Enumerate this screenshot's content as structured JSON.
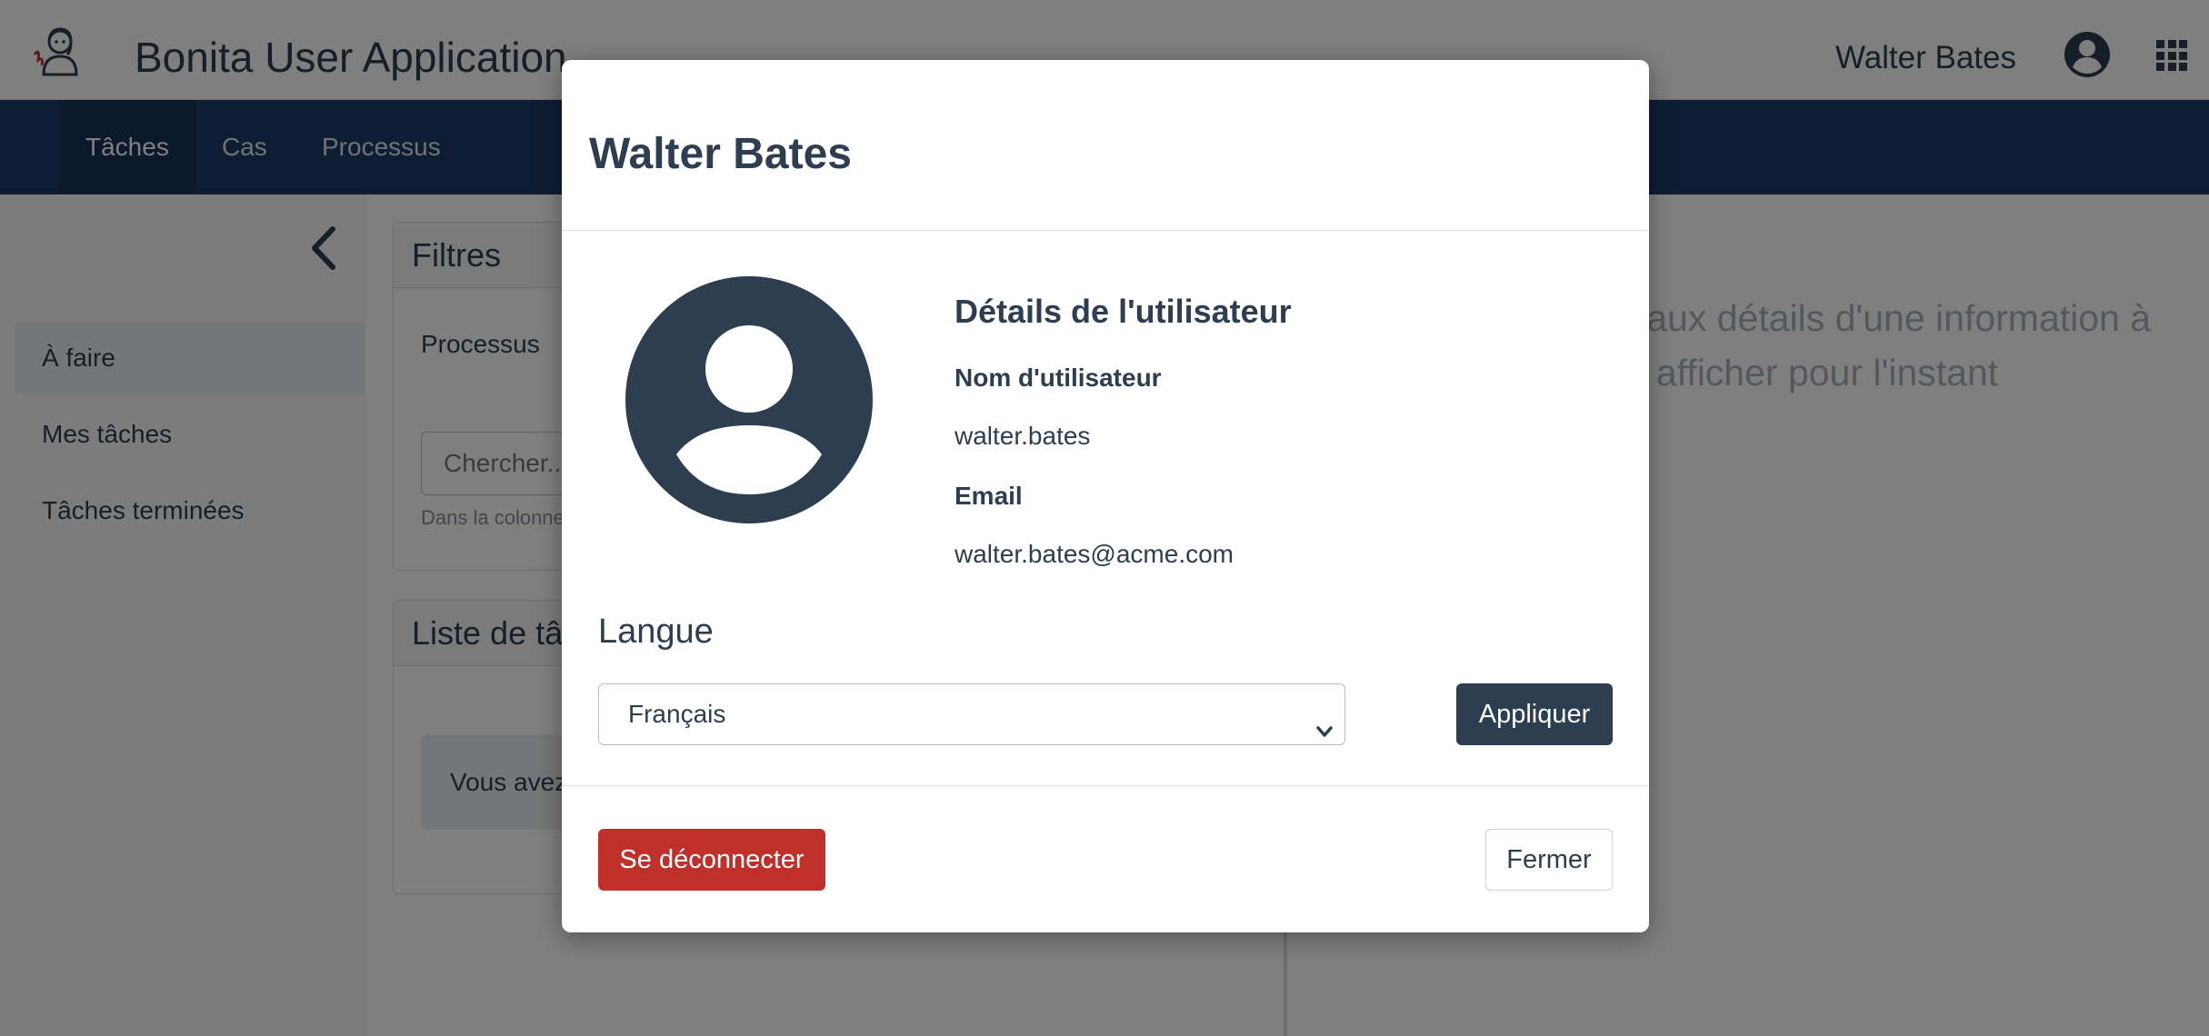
{
  "header": {
    "app_title": "Bonita User Application",
    "user_name": "Walter Bates",
    "logo_icon": "bonita-logo-icon",
    "user_icon": "user-circle-icon",
    "apps_icon": "apps-grid-icon"
  },
  "nav": {
    "items": [
      {
        "label": "Tâches",
        "active": true
      },
      {
        "label": "Cas",
        "active": false
      },
      {
        "label": "Processus",
        "active": false
      }
    ]
  },
  "sidebar": {
    "collapse_icon": "chevron-left-icon",
    "items": [
      {
        "label": "À faire",
        "active": true
      },
      {
        "label": "Mes tâches",
        "active": false
      },
      {
        "label": "Tâches terminées",
        "active": false
      }
    ]
  },
  "filters": {
    "title": "Filtres",
    "process_label": "Processus",
    "search_placeholder": "Chercher...",
    "search_help": "Dans la colonne"
  },
  "task_list": {
    "title": "Liste de tâ",
    "empty_message": "Vous avez"
  },
  "details": {
    "placeholder_text": "t dédiée aux détails d'une information à afficher pour l'instant"
  },
  "modal": {
    "title": "Walter Bates",
    "avatar_icon": "user-avatar-icon",
    "section_title": "Détails de l'utilisateur",
    "username_label": "Nom d'utilisateur",
    "username_value": "walter.bates",
    "email_label": "Email",
    "email_value": "walter.bates@acme.com",
    "language_title": "Langue",
    "language_selected": "Français",
    "apply_label": "Appliquer",
    "logout_label": "Se déconnecter",
    "close_label": "Fermer"
  },
  "colors": {
    "primary": "#2c3e50",
    "navbar": "#1d3a66",
    "danger": "#c0302b"
  }
}
